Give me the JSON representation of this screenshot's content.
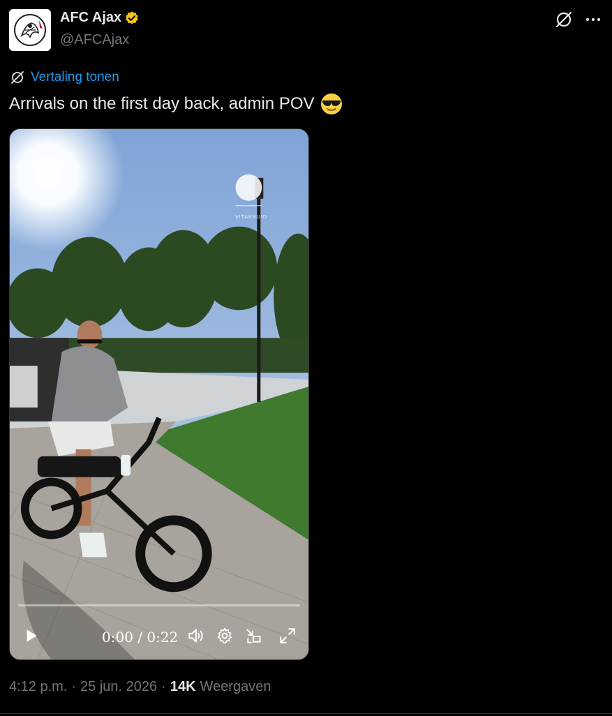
{
  "author": {
    "display_name": "AFC Ajax",
    "handle": "@AFCAjax",
    "avatar_icon": "ajax-crest-icon",
    "verified_icon": "verified-badge-icon",
    "verified_color": "#f5c518"
  },
  "header_actions": {
    "grok_icon": "grok-icon",
    "more_icon": "more-icon"
  },
  "translate": {
    "icon": "grok-icon",
    "label": "Vertaling tonen"
  },
  "tweet": {
    "text": "Arrivals on the first day back, admin POV",
    "emoji": "smiling-face-with-sunglasses"
  },
  "video": {
    "time": "0:00 / 0:22",
    "progress": 0,
    "overlay_logo_text": "VITAKRUID",
    "controls": [
      "play-icon",
      "volume-icon",
      "settings-icon",
      "dock-icon",
      "fullscreen-icon"
    ]
  },
  "meta": {
    "time": "4:12 p.m.",
    "separator": "·",
    "date": "25 jun. 2026",
    "views_count": "14K",
    "views_label": "Weergaven"
  },
  "colors": {
    "background": "#000000",
    "text": "#e7e9ea",
    "muted": "#71767b",
    "accent": "#1d9bf0"
  }
}
